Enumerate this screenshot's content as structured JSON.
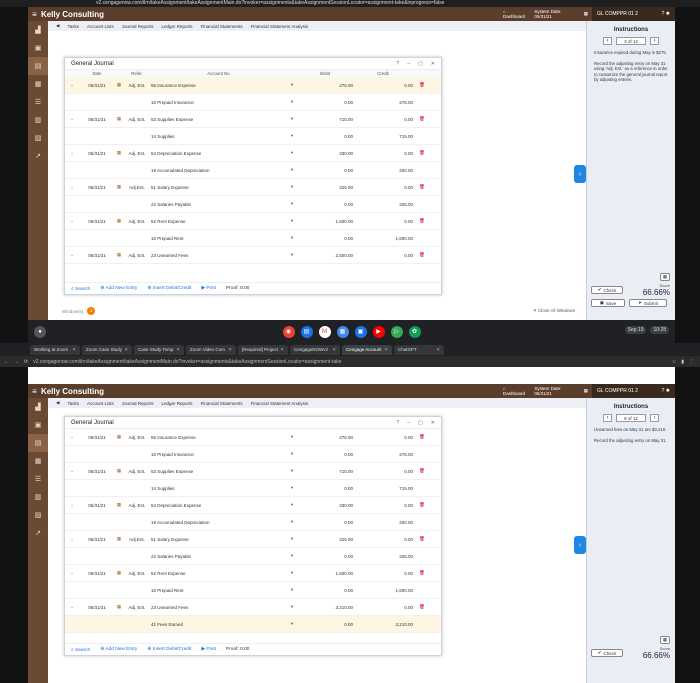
{
  "top": {
    "strip_text": "v2.cengagenow.com/ilrn/takeAssignment/takeAssignmentMain.do?invoker=assignments&takeAssignmentSessionLocator=assignment-take&inprogress=false",
    "instructions_page": "3 of 12",
    "instructions": [
      "Insurance expired during May is $275.",
      "Record the adjusting entry on May 31 using 'Adj. Ent.' as a reference in order to customize the general journal report by adjusting entries."
    ],
    "window_label": "Window(s)",
    "window_count": "1",
    "close_all": "Close All Windows",
    "score_label": "Score",
    "score_value": "66.66%",
    "check_label": "Check",
    "save_label": "Save",
    "submit_label": "Submit",
    "rows": [
      {
        "date": "05/31/21",
        "ref": "Adj. Ent.",
        "acct": "55 Insurance Expense",
        "debit": "275.00",
        "credit": "0.00",
        "first": true,
        "hl": true
      },
      {
        "date": "",
        "ref": "",
        "acct": "16 Prepaid Insurance",
        "debit": "0.00",
        "credit": "275.00",
        "first": false,
        "hl": false
      },
      {
        "date": "05/31/21",
        "ref": "Adj. Ent.",
        "acct": "53 Supplies Expense",
        "debit": "715.00",
        "credit": "0.00",
        "first": true,
        "hl": false
      },
      {
        "date": "",
        "ref": "",
        "acct": "14 Supplies",
        "debit": "0.00",
        "credit": "715.00",
        "first": false,
        "hl": false
      },
      {
        "date": "05/31/21",
        "ref": "Adj. Ent.",
        "acct": "54 Depreciation Expense",
        "debit": "330.00",
        "credit": "0.00",
        "first": true,
        "hl": false
      },
      {
        "date": "",
        "ref": "",
        "acct": "19 Accumulated Depreciation",
        "debit": "0.00",
        "credit": "330.00",
        "first": false,
        "hl": false
      },
      {
        "date": "05/31/21",
        "ref": "Adj.Ent.",
        "acct": "51 Salary Expense",
        "debit": "325.00",
        "credit": "0.00",
        "first": true,
        "hl": false
      },
      {
        "date": "",
        "ref": "",
        "acct": "22 Salaries Payable",
        "debit": "0.00",
        "credit": "325.00",
        "first": false,
        "hl": false
      },
      {
        "date": "05/31/21",
        "ref": "Adj. Ent.",
        "acct": "52 Rent Expense",
        "debit": "1,600.00",
        "credit": "0.00",
        "first": true,
        "hl": false
      },
      {
        "date": "",
        "ref": "",
        "acct": "15 Prepaid Rent",
        "debit": "0.00",
        "credit": "1,600.00",
        "first": false,
        "hl": false
      },
      {
        "date": "05/31/21",
        "ref": "Adj. Ent.",
        "acct": "23 Unearned Fees",
        "debit": "2,500.00",
        "credit": "0.00",
        "first": true,
        "hl": false
      }
    ]
  },
  "bottom": {
    "tabs": [
      "Working at Zoom",
      "Zoom Case Study",
      "Case Study Temp",
      "Zoom Video Com",
      "[Required] Project",
      "CengageNOWv2",
      "Cengage Account",
      "ChatGPT"
    ],
    "url": "v2.cengagenow.com/ilrn/takeAssignment/takeAssignmentMain.do?invoker=assignments&takeAssignmentSessionLocator=assignment-take",
    "instructions_page": "8 of 12",
    "instructions": [
      "Unearned fees on May 31 are $3,210.",
      "Record the adjusting entry on May 31."
    ],
    "score_label": "Score",
    "score_value": "66.66%",
    "check_label": "Check",
    "rows": [
      {
        "date": "05/31/21",
        "ref": "Adj. Ent.",
        "acct": "55 Insurance Expense",
        "debit": "275.00",
        "credit": "0.00",
        "first": true,
        "hl": false
      },
      {
        "date": "",
        "ref": "",
        "acct": "16 Prepaid Insurance",
        "debit": "0.00",
        "credit": "275.00",
        "first": false,
        "hl": false
      },
      {
        "date": "05/31/21",
        "ref": "Adj. Ent.",
        "acct": "53 Supplies Expense",
        "debit": "715.00",
        "credit": "0.00",
        "first": true,
        "hl": false
      },
      {
        "date": "",
        "ref": "",
        "acct": "14 Supplies",
        "debit": "0.00",
        "credit": "715.00",
        "first": false,
        "hl": false
      },
      {
        "date": "05/31/21",
        "ref": "Adj. Ent.",
        "acct": "54 Depreciation Expense",
        "debit": "330.00",
        "credit": "0.00",
        "first": true,
        "hl": false
      },
      {
        "date": "",
        "ref": "",
        "acct": "19 Accumulated Depreciation",
        "debit": "0.00",
        "credit": "330.00",
        "first": false,
        "hl": false
      },
      {
        "date": "05/31/21",
        "ref": "Adj.Ent.",
        "acct": "51 Salary Expense",
        "debit": "325.00",
        "credit": "0.00",
        "first": true,
        "hl": false
      },
      {
        "date": "",
        "ref": "",
        "acct": "22 Salaries Payable",
        "debit": "0.00",
        "credit": "325.00",
        "first": false,
        "hl": false
      },
      {
        "date": "05/31/21",
        "ref": "Adj. Ent.",
        "acct": "52 Rent Expense",
        "debit": "1,600.00",
        "credit": "0.00",
        "first": true,
        "hl": false
      },
      {
        "date": "",
        "ref": "",
        "acct": "15 Prepaid Rent",
        "debit": "0.00",
        "credit": "1,600.00",
        "first": false,
        "hl": false
      },
      {
        "date": "05/31/21",
        "ref": "Adj. Ent.",
        "acct": "23 Unearned Fees",
        "debit": "3,210.00",
        "credit": "0.00",
        "first": true,
        "hl": false
      },
      {
        "date": "",
        "ref": "",
        "acct": "41 Fees Earned",
        "debit": "0.00",
        "credit": "3,210.00",
        "first": false,
        "hl": true
      }
    ]
  },
  "common": {
    "app_title": "Kelly Consulting",
    "dashboard": "Dashboard",
    "system_date": "System Date: 05/31/21",
    "assignment": "GL COMPPR 01 2",
    "menu": [
      "Tasks",
      "Account Lists",
      "Journal Reports",
      "Ledger Reports",
      "Financial Statements",
      "Financial Statement Analysis"
    ],
    "instructions_title": "Instructions",
    "journal_title": "General Journal",
    "col_date": "Date",
    "col_refer": "Refer.",
    "col_acct": "Account No.",
    "col_debit": "Debit",
    "col_credit": "Credit",
    "search": "Search",
    "add_entry": "Add New Entry",
    "insert": "Insert Debit/Credit",
    "post": "Post",
    "proof": "Proof: 0.00",
    "taskbar_date": "Sep 19",
    "taskbar_time": "10:28"
  }
}
